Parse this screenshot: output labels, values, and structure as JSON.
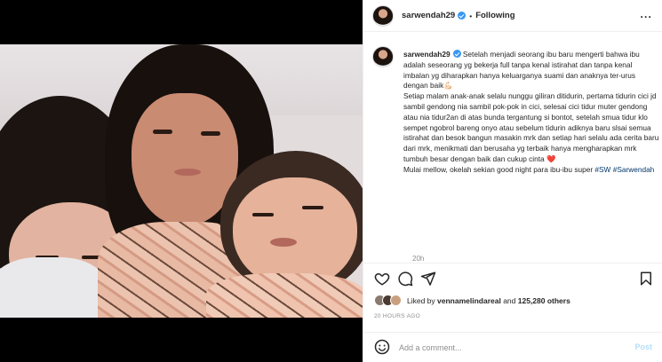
{
  "header": {
    "username": "sarwendah29",
    "separator": "•",
    "follow_status": "Following",
    "more_glyph": "···"
  },
  "caption": {
    "username": "sarwendah29",
    "paragraphs": [
      "Setelah menjadi seorang ibu baru mengerti bahwa ibu adalah seseorang yg bekerja full tanpa kenal istirahat dan tanpa kenal imbalan yg diharapkan hanya keluarganya suami dan anaknya ter-urus dengan baik💪🏻",
      "Setiap malam anak-anak selalu nunggu giliran ditidurin, pertama tidurin cici jd sambil gendong nia sambil pok-pok in cici, selesai cici tidur muter gendong atau nia tidur2an di atas bunda tergantung si bontot, setelah smua tidur klo sempet ngobrol bareng onyo atau sebelum tidurin adiknya baru slsai semua istirahat dan besok bangun masakin mrk dan setiap hari selalu ada cerita baru dari mrk, menikmati dan berusaha yg terbaik hanya mengharapkan mrk tumbuh besar dengan baik dan cukup cinta ❤️",
      "Mulai mellow, okelah sekian good night para ibu-ibu super"
    ],
    "hashtags": [
      "#SW",
      "#Sarwendah"
    ],
    "time_ago": "20h"
  },
  "likes": {
    "liked_by_prefix": "Liked by ",
    "liked_by_user": "vennamelindareal",
    "and_text": " and ",
    "others_count": "125,280 others"
  },
  "timestamp": "20 HOURS AGO",
  "comment": {
    "placeholder": "Add a comment...",
    "post_label": "Post"
  },
  "icons": {
    "heart": "heart-icon",
    "comment": "comment-icon",
    "share": "share-icon",
    "save": "bookmark-icon",
    "emoji": "emoji-icon",
    "tag": "user-tag-icon",
    "more": "more-options-icon"
  },
  "colors": {
    "verified": "#3897f0",
    "hashtag": "#00376b",
    "muted": "#8e8e8e",
    "post_disabled": "#b2dffc"
  }
}
